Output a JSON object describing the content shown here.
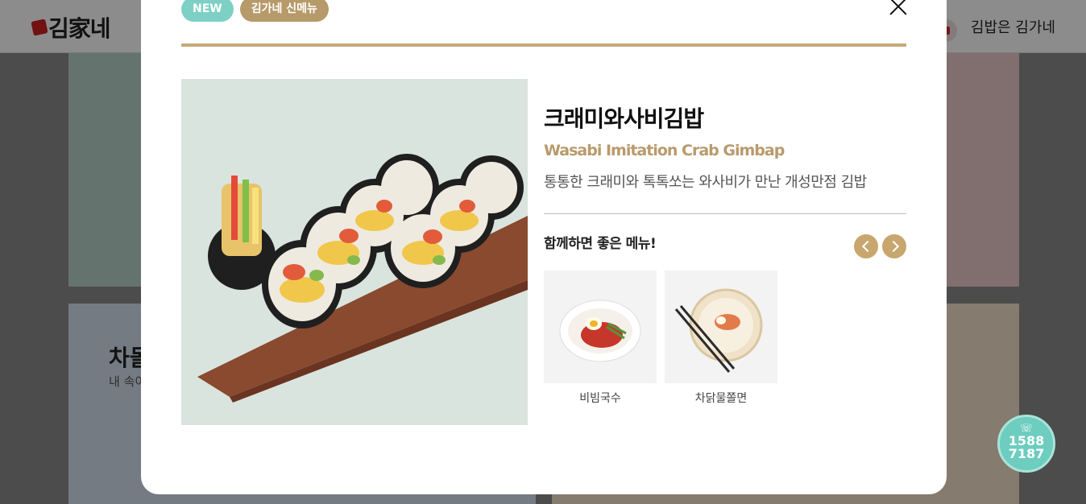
{
  "header": {
    "logo_text": "김家네",
    "right_text": "김밥은 김가네"
  },
  "background": {
    "card_title": "차돌",
    "card_subtitle": "내 속이"
  },
  "modal": {
    "badges": [
      {
        "label": "NEW",
        "color": "#7fd0c4"
      },
      {
        "label": "김가네 신메뉴",
        "color": "#b79a6a"
      }
    ],
    "title": "크래미와사비김밥",
    "title_en": "Wasabi Imitation Crab Gimbap",
    "description": "통통한 크래미와 톡톡쏘는 와사비가 만난 개성만점 김밥",
    "pairing_title": "함께하면 좋은 메뉴!",
    "pairings": [
      {
        "label": "비빔국수"
      },
      {
        "label": "차닭물쫄면"
      }
    ],
    "accent_color": "#c9a97a"
  },
  "call_button": {
    "line1": "1588",
    "line2": "7187"
  }
}
